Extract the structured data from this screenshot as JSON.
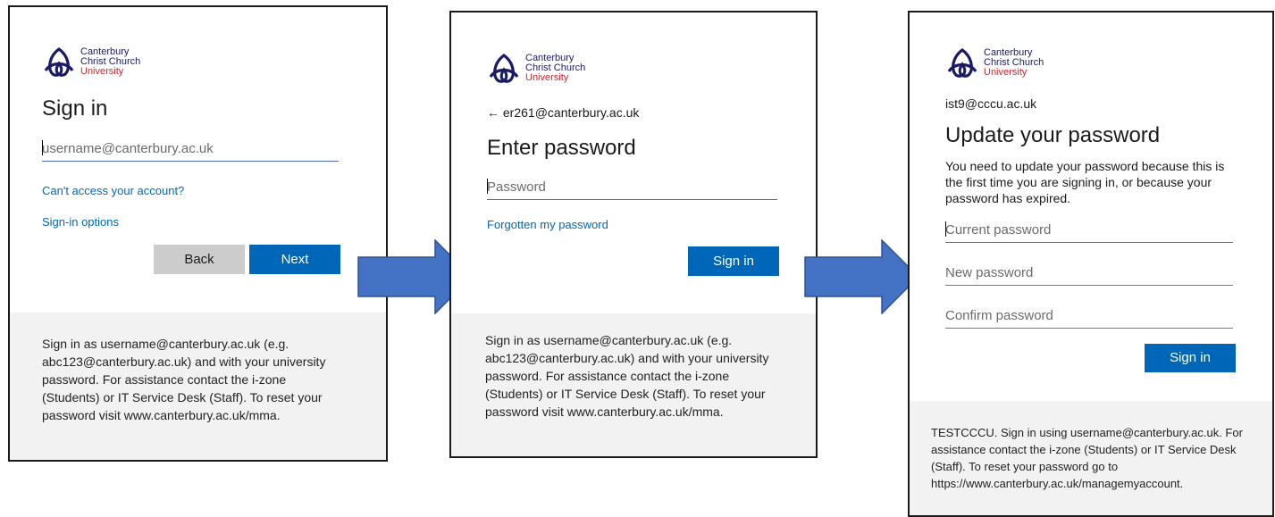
{
  "brand": {
    "line1": "Canterbury",
    "line2": "Christ Church",
    "line3": "University",
    "navy": "#1a1a66",
    "red": "#d2232a"
  },
  "accent_color": "#0067b8",
  "panel1": {
    "title": "Sign in",
    "username_placeholder": "username@canterbury.ac.uk",
    "cant_access_link": "Can't access your account?",
    "signin_options_link": "Sign-in options",
    "back_label": "Back",
    "next_label": "Next",
    "footer": "Sign in as username@canterbury.ac.uk (e.g. abc123@canterbury.ac.uk) and with your university password. For assistance contact the i-zone (Students) or IT Service Desk (Staff). To reset your password visit www.canterbury.ac.uk/mma."
  },
  "panel2": {
    "back_arrow": "←",
    "identity": "er261@canterbury.ac.uk",
    "title": "Enter password",
    "password_placeholder": "Password",
    "forgot_link": "Forgotten my password",
    "signin_label": "Sign in",
    "footer": "Sign in as username@canterbury.ac.uk (e.g. abc123@canterbury.ac.uk) and with your university password. For assistance contact the i-zone (Students) or IT Service Desk (Staff). To reset your password visit www.canterbury.ac.uk/mma."
  },
  "panel3": {
    "identity": "ist9@cccu.ac.uk",
    "title": "Update your password",
    "description": "You need to update your password because this is the first time you are signing in, or because your password has expired.",
    "current_placeholder": "Current password",
    "new_placeholder": "New password",
    "confirm_placeholder": "Confirm password",
    "signin_label": "Sign in",
    "footer": "TESTCCCU. Sign in using username@canterbury.ac.uk. For assistance contact the i-zone (Students) or IT Service Desk (Staff). To reset your password go to https://www.canterbury.ac.uk/managemyaccount."
  }
}
